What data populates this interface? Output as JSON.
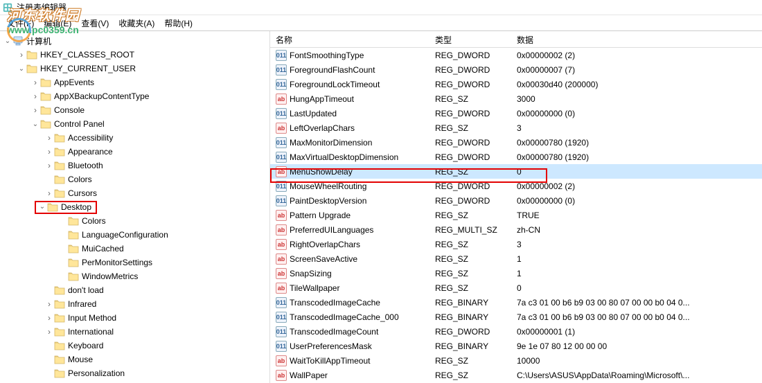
{
  "window": {
    "title": "注册表编辑器"
  },
  "menu": {
    "file": "文件(F)",
    "edit": "编辑(E)",
    "view": "查看(V)",
    "fav": "收藏夹(A)",
    "help": "帮助(H)"
  },
  "watermark": {
    "top": "河东软件园",
    "bot": "www.pc0359.cn"
  },
  "tree": {
    "root": "计算机",
    "hkcr": "HKEY_CLASSES_ROOT",
    "hkcu": "HKEY_CURRENT_USER",
    "appevents": "AppEvents",
    "appx": "AppXBackupContentType",
    "console": "Console",
    "cp": "Control Panel",
    "accessibility": "Accessibility",
    "appearance": "Appearance",
    "bluetooth": "Bluetooth",
    "colors": "Colors",
    "cursors": "Cursors",
    "desktop": "Desktop",
    "colors2": "Colors",
    "langconf": "LanguageConfiguration",
    "muicached": "MuiCached",
    "permon": "PerMonitorSettings",
    "winmetrics": "WindowMetrics",
    "dontload": "don't load",
    "infrared": "Infrared",
    "inputmethod": "Input Method",
    "intl": "International",
    "keyboard": "Keyboard",
    "mouse": "Mouse",
    "pers": "Personalization"
  },
  "list": {
    "hdr_name": "名称",
    "hdr_type": "类型",
    "hdr_data": "数据",
    "rows": [
      {
        "icon": "bin",
        "name": "FontSmoothingType",
        "type": "REG_DWORD",
        "data": "0x00000002 (2)"
      },
      {
        "icon": "bin",
        "name": "ForegroundFlashCount",
        "type": "REG_DWORD",
        "data": "0x00000007 (7)"
      },
      {
        "icon": "bin",
        "name": "ForegroundLockTimeout",
        "type": "REG_DWORD",
        "data": "0x00030d40 (200000)"
      },
      {
        "icon": "sz",
        "name": "HungAppTimeout",
        "type": "REG_SZ",
        "data": "3000"
      },
      {
        "icon": "bin",
        "name": "LastUpdated",
        "type": "REG_DWORD",
        "data": "0x00000000 (0)"
      },
      {
        "icon": "sz",
        "name": "LeftOverlapChars",
        "type": "REG_SZ",
        "data": "3"
      },
      {
        "icon": "bin",
        "name": "MaxMonitorDimension",
        "type": "REG_DWORD",
        "data": "0x00000780 (1920)"
      },
      {
        "icon": "bin",
        "name": "MaxVirtualDesktopDimension",
        "type": "REG_DWORD",
        "data": "0x00000780 (1920)"
      },
      {
        "icon": "sz",
        "name": "MenuShowDelay",
        "type": "REG_SZ",
        "data": "0",
        "sel": true
      },
      {
        "icon": "bin",
        "name": "MouseWheelRouting",
        "type": "REG_DWORD",
        "data": "0x00000002 (2)"
      },
      {
        "icon": "bin",
        "name": "PaintDesktopVersion",
        "type": "REG_DWORD",
        "data": "0x00000000 (0)"
      },
      {
        "icon": "sz",
        "name": "Pattern Upgrade",
        "type": "REG_SZ",
        "data": "TRUE"
      },
      {
        "icon": "sz",
        "name": "PreferredUILanguages",
        "type": "REG_MULTI_SZ",
        "data": "zh-CN"
      },
      {
        "icon": "sz",
        "name": "RightOverlapChars",
        "type": "REG_SZ",
        "data": "3"
      },
      {
        "icon": "sz",
        "name": "ScreenSaveActive",
        "type": "REG_SZ",
        "data": "1"
      },
      {
        "icon": "sz",
        "name": "SnapSizing",
        "type": "REG_SZ",
        "data": "1"
      },
      {
        "icon": "sz",
        "name": "TileWallpaper",
        "type": "REG_SZ",
        "data": "0"
      },
      {
        "icon": "bin",
        "name": "TranscodedImageCache",
        "type": "REG_BINARY",
        "data": "7a c3 01 00 b6 b9 03 00 80 07 00 00 b0 04 0..."
      },
      {
        "icon": "bin",
        "name": "TranscodedImageCache_000",
        "type": "REG_BINARY",
        "data": "7a c3 01 00 b6 b9 03 00 80 07 00 00 b0 04 0..."
      },
      {
        "icon": "bin",
        "name": "TranscodedImageCount",
        "type": "REG_DWORD",
        "data": "0x00000001 (1)"
      },
      {
        "icon": "bin",
        "name": "UserPreferencesMask",
        "type": "REG_BINARY",
        "data": "9e 1e 07 80 12 00 00 00"
      },
      {
        "icon": "sz",
        "name": "WaitToKillAppTimeout",
        "type": "REG_SZ",
        "data": "10000"
      },
      {
        "icon": "sz",
        "name": "WallPaper",
        "type": "REG_SZ",
        "data": "C:\\Users\\ASUS\\AppData\\Roaming\\Microsoft\\..."
      }
    ]
  }
}
